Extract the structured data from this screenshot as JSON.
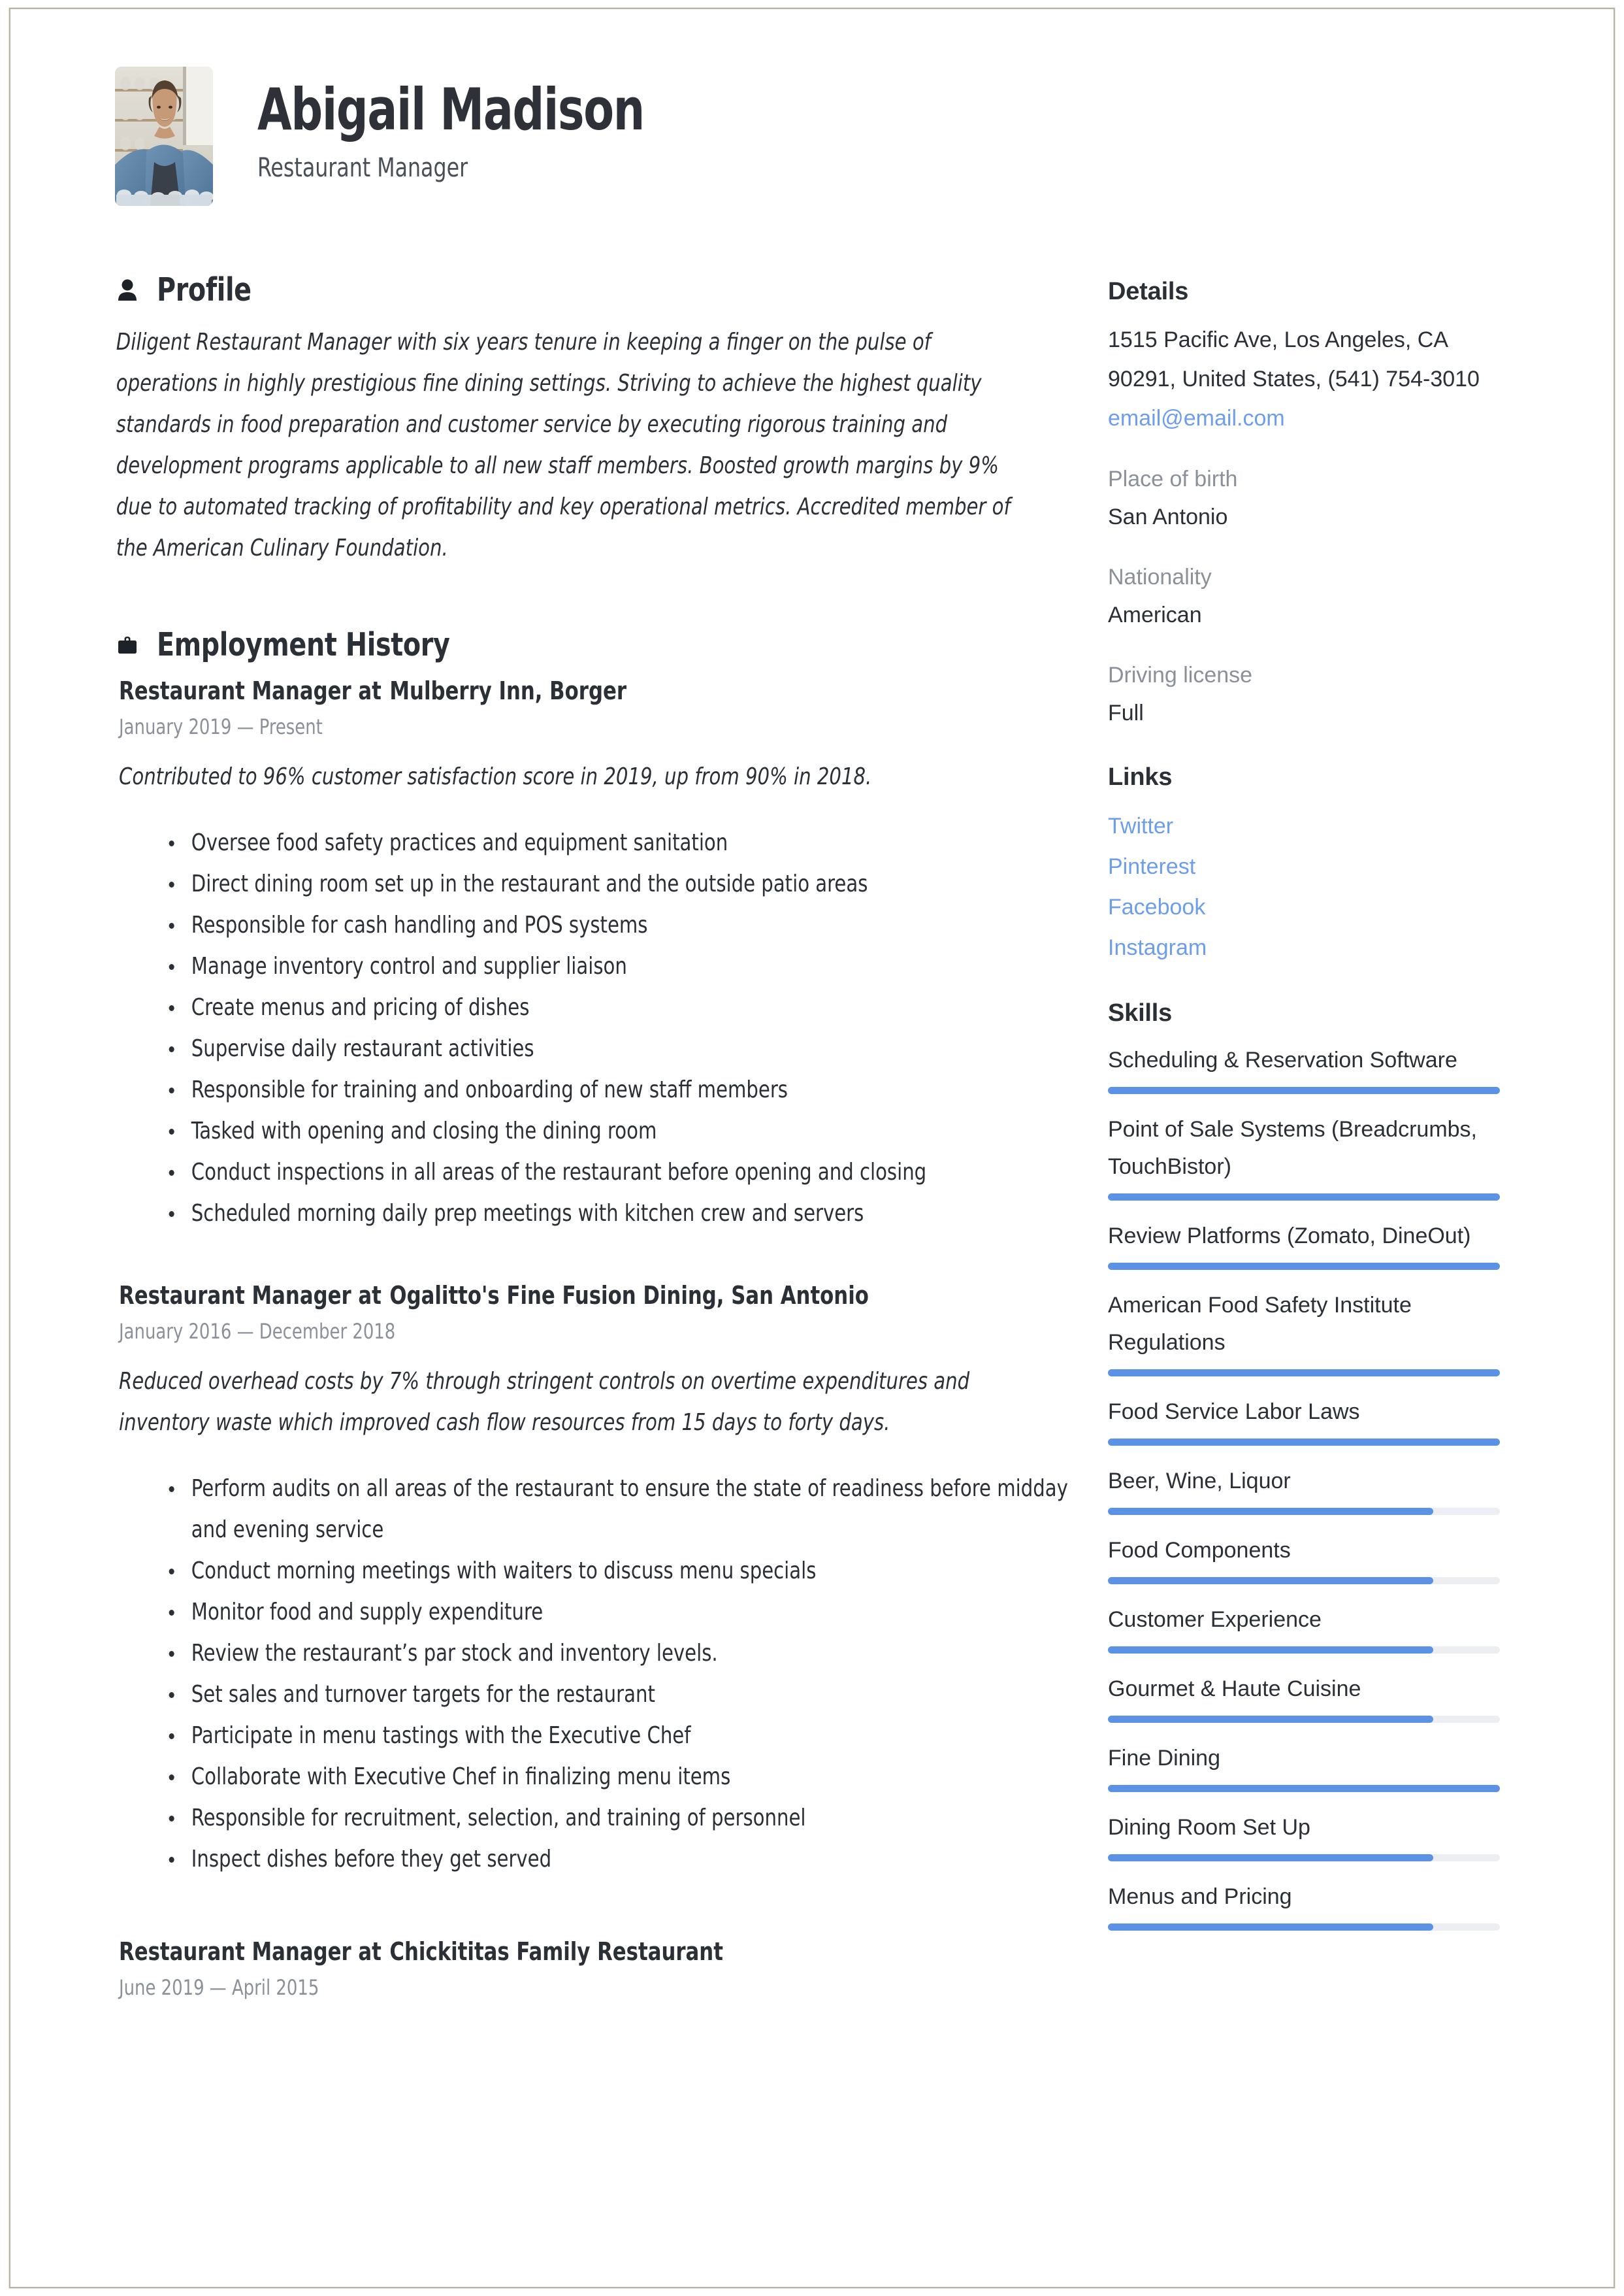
{
  "header": {
    "name": "Abigail Madison",
    "title": "Restaurant Manager",
    "avatar_alt": "profile-photo"
  },
  "sections": {
    "profile": {
      "heading": "Profile",
      "icon": "person-icon",
      "text": "Diligent Restaurant Manager with six years tenure in keeping a finger on the pulse of operations in highly prestigious fine dining settings. Striving to achieve the highest quality standards in food preparation and customer service by executing rigorous training and development programs applicable to all new staff members. Boosted growth margins by 9% due to automated tracking of profitability and key operational metrics. Accredited member of the American Culinary Foundation."
    },
    "employment": {
      "heading": "Employment History",
      "icon": "briefcase-icon",
      "jobs": [
        {
          "role": "Restaurant Manager at",
          "employer": "Mulberry Inn, Borger",
          "dates": "January 2019 — Present",
          "summary": "Contributed to 96% customer satisfaction score in 2019, up from 90% in 2018.",
          "bullets": [
            "Oversee food safety practices and equipment sanitation",
            "Direct dining room set up in the restaurant and the outside patio areas",
            "Responsible for cash handling and POS systems",
            "Manage inventory control and supplier liaison",
            "Create menus and pricing of dishes",
            "Supervise daily restaurant activities",
            "Responsible for training and onboarding of new staff members",
            "Tasked with opening and closing the dining room",
            "Conduct inspections in all areas of the restaurant before opening and closing",
            "Scheduled morning daily prep meetings with kitchen crew and servers"
          ]
        },
        {
          "role": "Restaurant Manager at",
          "employer": "Ogalitto's Fine Fusion Dining, San Antonio",
          "dates": "January 2016 — December 2018",
          "summary": "Reduced overhead costs by 7% through stringent controls on overtime expenditures and inventory waste which improved cash flow resources from 15 days to forty days.",
          "bullets": [
            "Perform audits on all areas of the restaurant to ensure the state of readiness before midday and evening service",
            "Conduct morning meetings with waiters to discuss menu specials",
            "Monitor food and supply expenditure",
            "Review the restaurant’s par stock and inventory levels.",
            "Set sales and turnover targets for the restaurant",
            "Participate in menu tastings with the Executive Chef",
            "Collaborate with Executive Chef in finalizing menu items",
            "Responsible for recruitment, selection, and training of personnel",
            "Inspect dishes before they get served"
          ]
        },
        {
          "role": "Restaurant Manager at",
          "employer": "Chickititas Family Restaurant",
          "dates": "June 2019 — April 2015",
          "summary": "",
          "bullets": []
        }
      ]
    }
  },
  "sidebar": {
    "details": {
      "heading": "Details",
      "address": "1515 Pacific Ave, Los Angeles, CA 90291, United States, (541) 754-3010",
      "email": "email@email.com",
      "fields": [
        {
          "label": "Place of birth",
          "value": "San Antonio"
        },
        {
          "label": "Nationality",
          "value": "American"
        },
        {
          "label": "Driving license",
          "value": "Full"
        }
      ]
    },
    "links": {
      "heading": "Links",
      "items": [
        "Twitter",
        "Pinterest",
        "Facebook",
        "Instagram"
      ]
    },
    "skills": {
      "heading": "Skills",
      "items": [
        {
          "name": "Scheduling & Reservation Software",
          "level": 100
        },
        {
          "name": "Point of Sale Systems (Breadcrumbs, TouchBistor)",
          "level": 100
        },
        {
          "name": "Review Platforms (Zomato, DineOut)",
          "level": 100
        },
        {
          "name": "American Food Safety Institute Regulations",
          "level": 100
        },
        {
          "name": "Food Service Labor Laws",
          "level": 100
        },
        {
          "name": "Beer, Wine, Liquor",
          "level": 83
        },
        {
          "name": "Food Components",
          "level": 83
        },
        {
          "name": "Customer Experience",
          "level": 83
        },
        {
          "name": "Gourmet & Haute Cuisine",
          "level": 83
        },
        {
          "name": "Fine Dining",
          "level": 100
        },
        {
          "name": "Dining Room Set Up",
          "level": 83
        },
        {
          "name": "Menus and Pricing",
          "level": 83
        }
      ]
    }
  },
  "colors": {
    "accent_blue": "#5b92e5",
    "link_blue": "#6d9eeb",
    "text": "#2b2f36",
    "muted": "#8b9099",
    "track": "#eceef1"
  }
}
